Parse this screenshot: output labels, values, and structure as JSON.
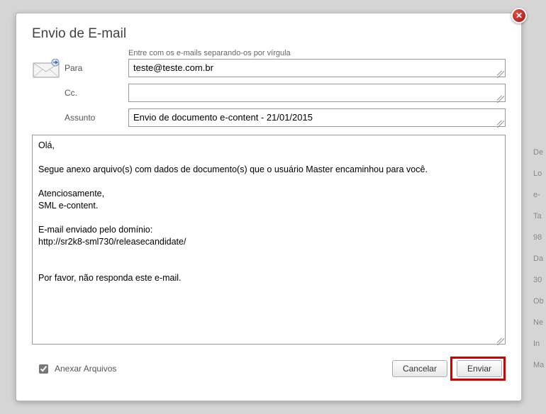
{
  "modal": {
    "title": "Envio de E-mail",
    "help_text": "Entre com os e-mails separando-os por vírgula",
    "labels": {
      "para": "Para",
      "cc": "Cc.",
      "assunto": "Assunto"
    },
    "fields": {
      "para": "teste@teste.com.br",
      "cc": "",
      "assunto": "Envio de documento e-content - 21/01/2015"
    },
    "body": "Olá,\n\nSegue anexo arquivo(s) com dados de documento(s) que o usuário Master encaminhou para você.\n\nAtenciosamente,\nSML e-content.\n\nE-mail enviado pelo domínio:\nhttp://sr2k8-sml730/releasecandidate/\n\n\nPor favor, não responda este e-mail.",
    "attach_label": "Anexar Arquivos",
    "attach_checked": true,
    "buttons": {
      "cancel": "Cancelar",
      "send": "Enviar"
    },
    "close_glyph": "✕"
  },
  "background": {
    "snips": [
      "De",
      "Lo",
      "e-",
      "Ta",
      "98",
      "Da",
      "30",
      "Ob",
      "Ne",
      "In",
      "Ma"
    ]
  }
}
